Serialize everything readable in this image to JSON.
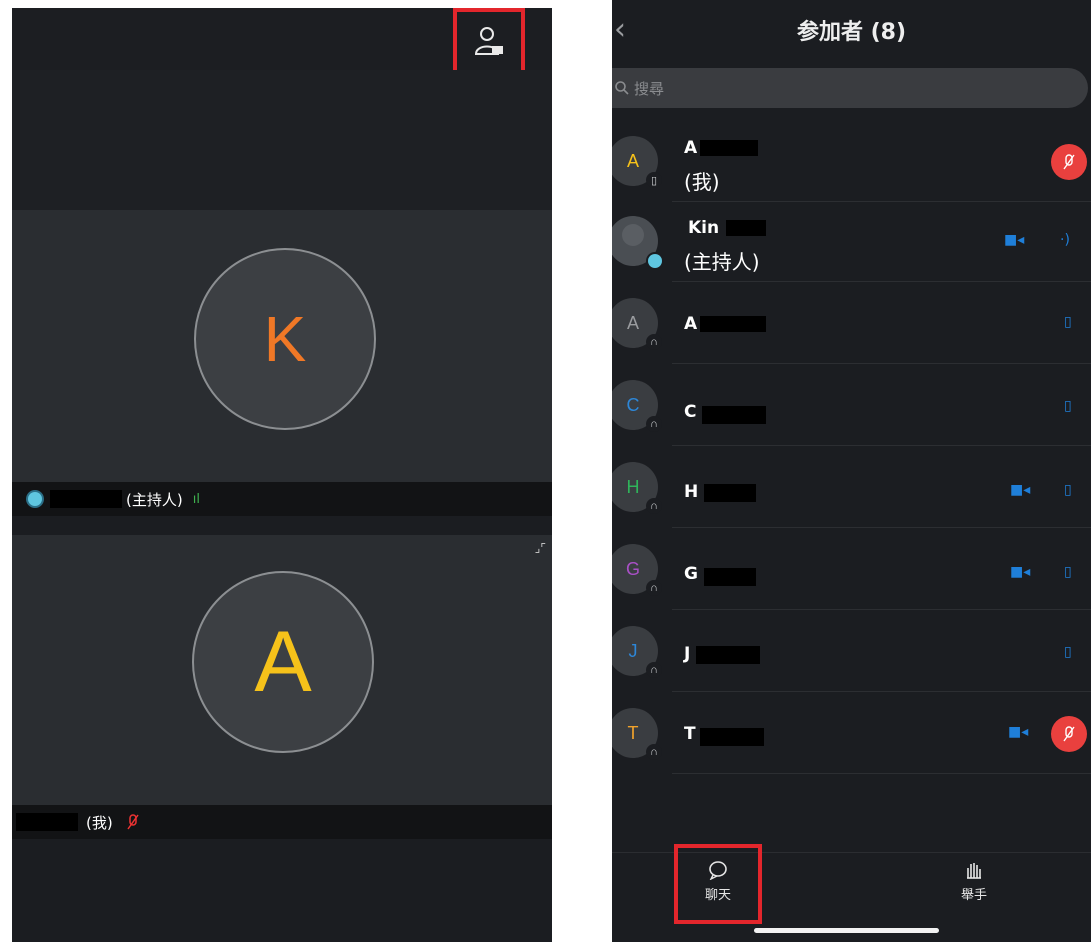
{
  "left": {
    "host_tile": {
      "initial": "K",
      "initial_color": "#f07826",
      "label": "(主持人)"
    },
    "self_tile": {
      "initial": "A",
      "initial_color": "#f6c21a",
      "label": "(我)"
    },
    "participants_icon": "participants-icon"
  },
  "right": {
    "title": "参加者 (8)",
    "back_icon": "chevron-left-icon",
    "search_placeholder": "搜尋",
    "participants": [
      {
        "initial": "A",
        "name": "A",
        "sub": "(我)",
        "color": "#f6c21a",
        "badge": "phone",
        "mic": "muted-red"
      },
      {
        "initial": "",
        "name": "Kin",
        "sub": "(主持人)",
        "color": "#9aa0a6",
        "badge": "host",
        "mic": "speaking",
        "video": true
      },
      {
        "initial": "A",
        "name": "A",
        "sub": "",
        "color": "#9a9c9f",
        "badge": "audio",
        "mic": "on"
      },
      {
        "initial": "C",
        "name": "C",
        "sub": "",
        "color": "#2d87d8",
        "badge": "audio",
        "mic": "on"
      },
      {
        "initial": "H",
        "name": "H",
        "sub": "",
        "color": "#2fb45a",
        "badge": "audio",
        "mic": "on",
        "video": true
      },
      {
        "initial": "G",
        "name": "G",
        "sub": "",
        "color": "#a950c6",
        "badge": "audio",
        "mic": "on",
        "video": true
      },
      {
        "initial": "J",
        "name": "J",
        "sub": "",
        "color": "#2d87d8",
        "badge": "audio",
        "mic": "on"
      },
      {
        "initial": "T",
        "name": "T",
        "sub": "",
        "color": "#f0a22c",
        "badge": "audio",
        "mic": "muted-red",
        "video": true
      }
    ],
    "tabs": {
      "chat_label": "聊天",
      "raise_hand_label": "舉手"
    }
  }
}
